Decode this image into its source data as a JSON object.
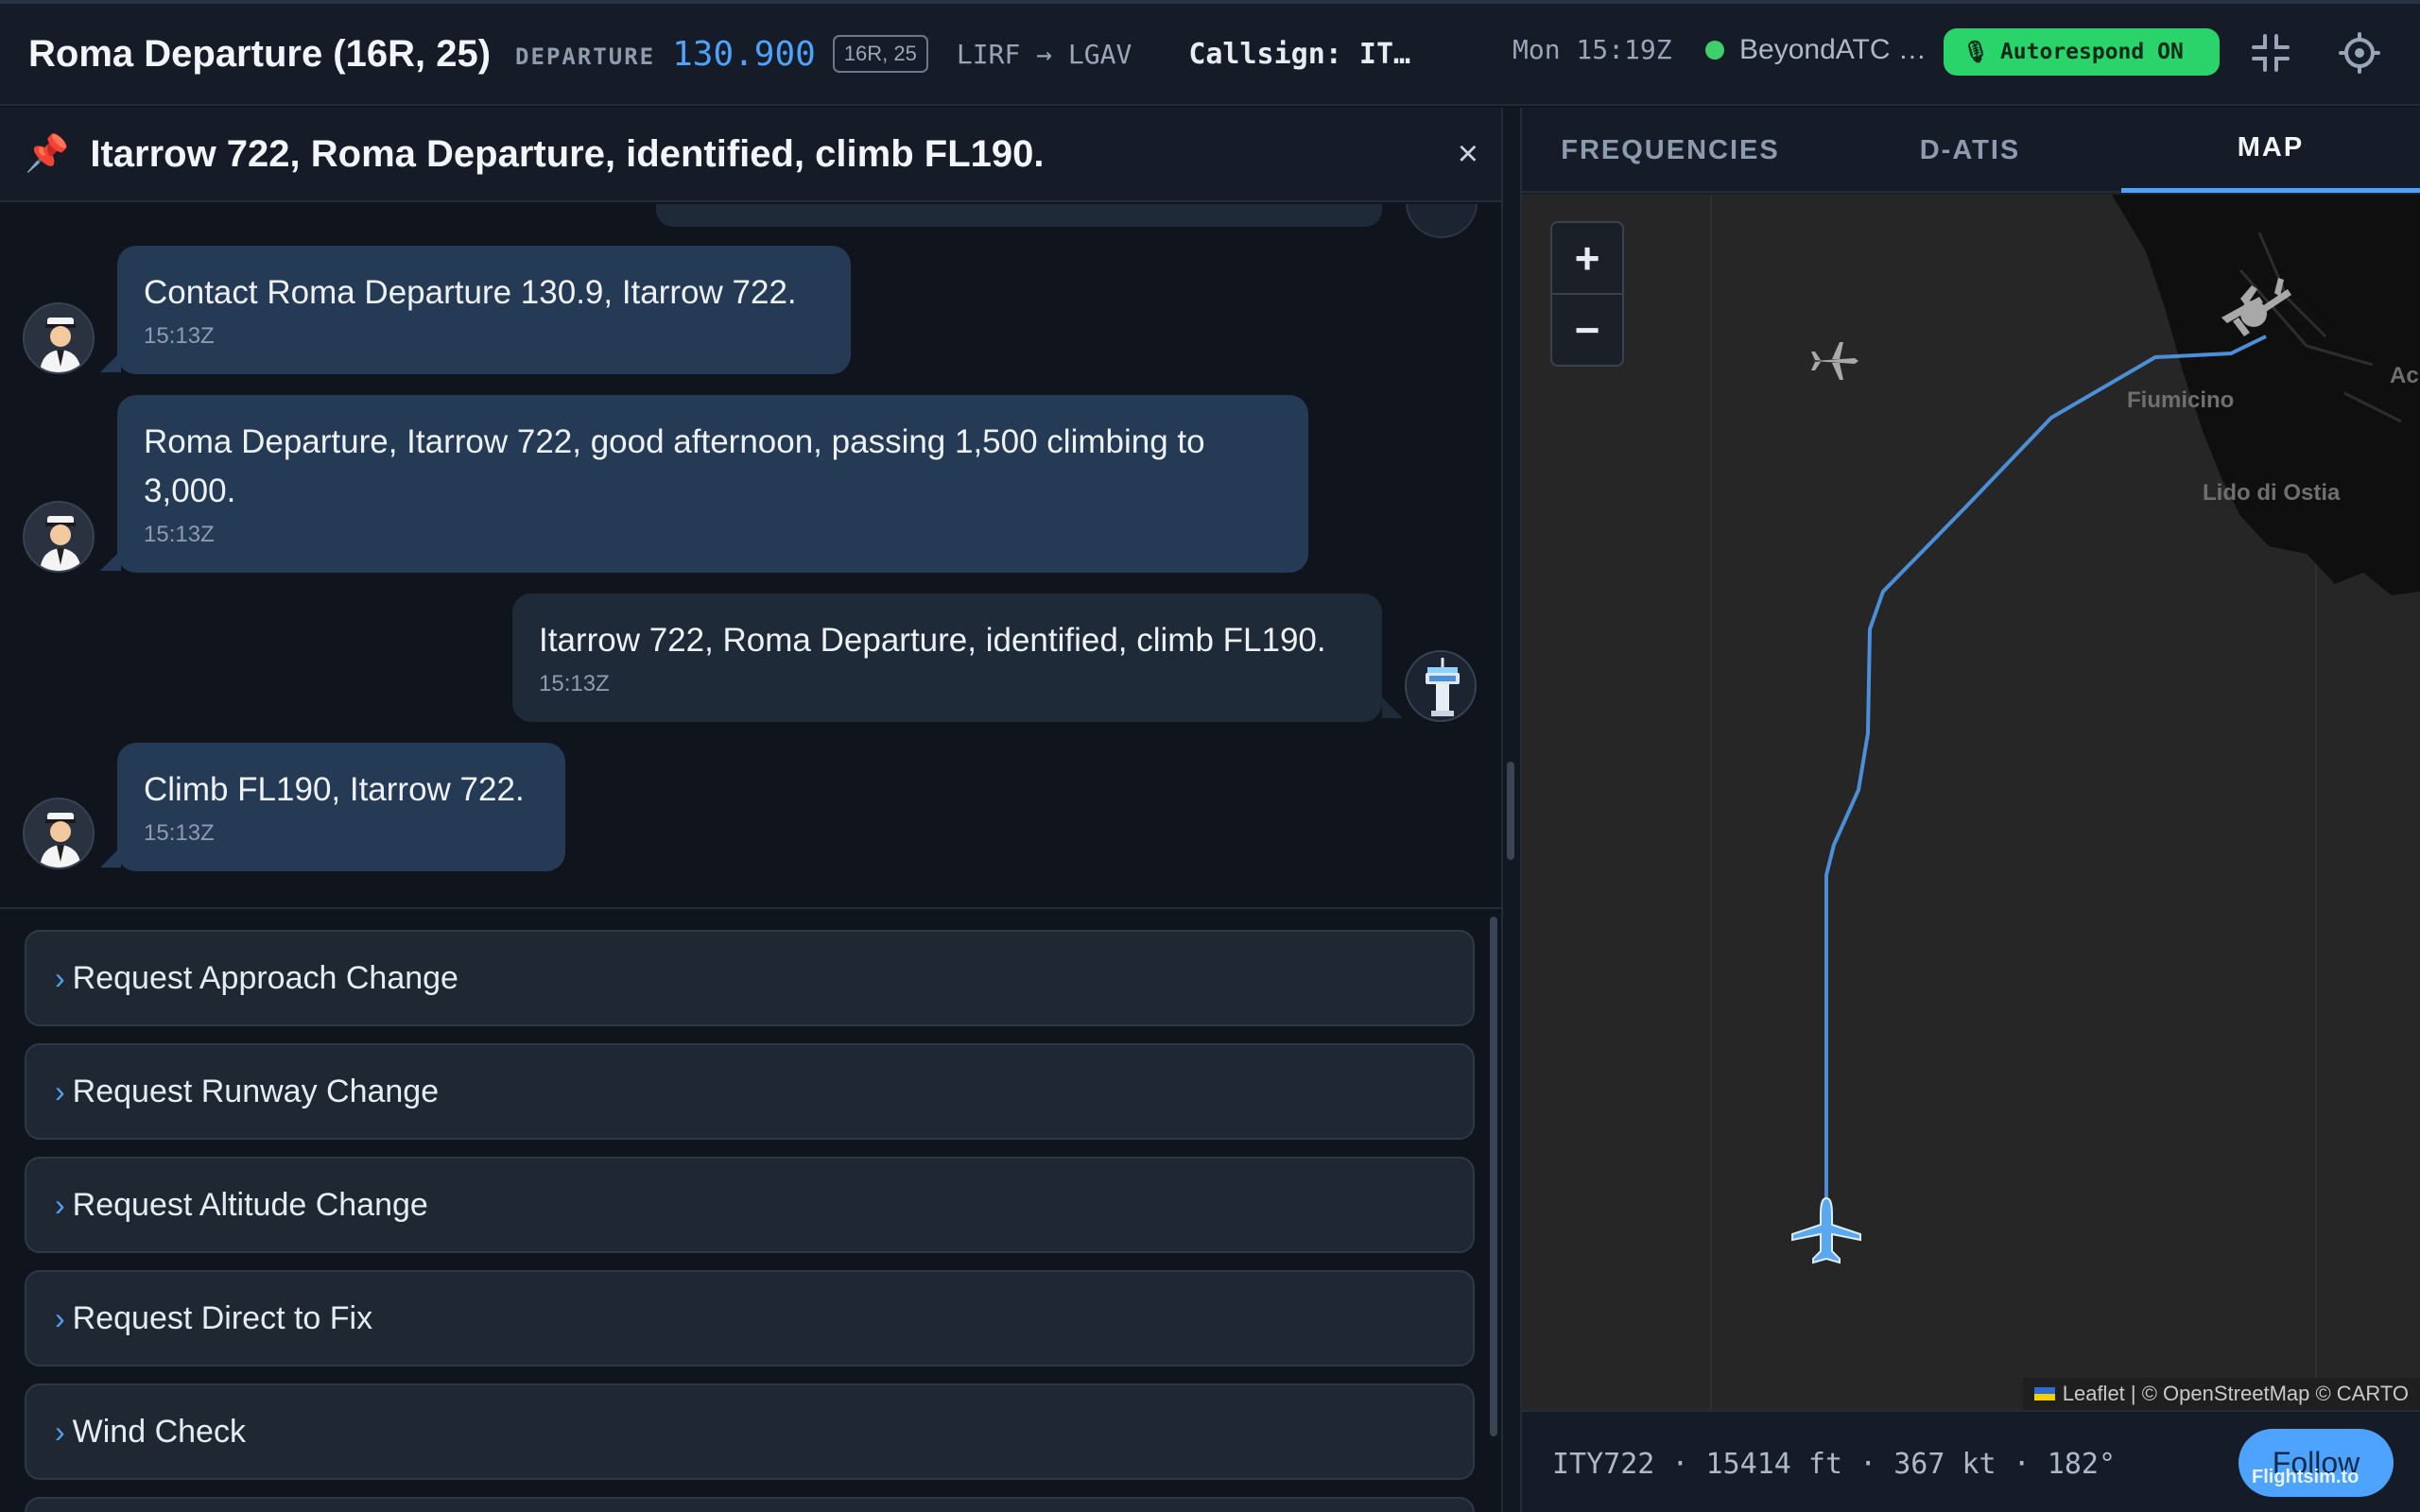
{
  "header": {
    "title": "Roma Departure (16R, 25)",
    "role": "DEPARTURE",
    "frequency": "130.900",
    "runway_badge": "16R, 25",
    "route": "LIRF → LGAV",
    "callsign": "Callsign: IT…",
    "time": "Mon 15:19Z",
    "status_label": "BeyondATC …",
    "autorespond": "Autorespond ON",
    "accent": "#4da3ff",
    "status_color": "#3fcf6b"
  },
  "pinned": {
    "icon": "pushpin-icon",
    "text": "Itarrow 722, Roma Departure, identified, climb FL190.",
    "close": "×"
  },
  "messages": [
    {
      "from": "pilot",
      "text": "Contact Roma Departure 130.9, Itarrow 722.",
      "time": "15:13Z"
    },
    {
      "from": "pilot",
      "text": "Roma Departure, Itarrow 722, good afternoon, passing 1,500 climbing to 3,000.",
      "time": "15:13Z"
    },
    {
      "from": "atc",
      "text": "Itarrow 722, Roma Departure, identified, climb FL190.",
      "time": "15:13Z"
    },
    {
      "from": "pilot",
      "text": "Climb FL190, Itarrow 722.",
      "time": "15:13Z"
    }
  ],
  "actions": [
    {
      "label": "Request Approach Change"
    },
    {
      "label": "Request Runway Change"
    },
    {
      "label": "Request Altitude Change"
    },
    {
      "label": "Request Direct to Fix"
    },
    {
      "label": "Wind Check"
    }
  ],
  "tabs": [
    {
      "label": "FREQUENCIES",
      "active": false
    },
    {
      "label": "D-ATIS",
      "active": false
    },
    {
      "label": "MAP",
      "active": true
    }
  ],
  "map": {
    "zoom_in": "+",
    "zoom_out": "−",
    "labels": {
      "fiumicino": "Fiumicino",
      "lido": "Lido di Ostia",
      "edge": "Ac"
    },
    "attribution": "Leaflet | © OpenStreetMap © CARTO"
  },
  "footer": {
    "info": "ITY722 · 15414 ft · 367 kt · 182°",
    "follow": "Follow",
    "watermark": "Flightsim.to"
  }
}
